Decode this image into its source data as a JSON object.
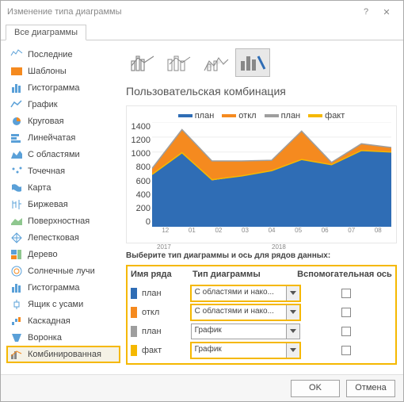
{
  "title": "Изменение типа диаграммы",
  "tab": "Все диаграммы",
  "sidebar": {
    "items": [
      {
        "label": "Последние"
      },
      {
        "label": "Шаблоны"
      },
      {
        "label": "Гистограмма"
      },
      {
        "label": "График"
      },
      {
        "label": "Круговая"
      },
      {
        "label": "Линейчатая"
      },
      {
        "label": "С областями"
      },
      {
        "label": "Точечная"
      },
      {
        "label": "Карта"
      },
      {
        "label": "Биржевая"
      },
      {
        "label": "Поверхностная"
      },
      {
        "label": "Лепестковая"
      },
      {
        "label": "Дерево"
      },
      {
        "label": "Солнечные лучи"
      },
      {
        "label": "Гистограмма"
      },
      {
        "label": "Ящик с усами"
      },
      {
        "label": "Каскадная"
      },
      {
        "label": "Воронка"
      },
      {
        "label": "Комбинированная"
      }
    ]
  },
  "heading": "Пользовательская комбинация",
  "legend": [
    {
      "name": "план",
      "color": "#2f6db5"
    },
    {
      "name": "откл",
      "color": "#f58a1f"
    },
    {
      "name": "план",
      "color": "#9e9e9e"
    },
    {
      "name": "факт",
      "color": "#f5b800"
    }
  ],
  "selector_label": "Выберите тип диаграммы и ось для рядов данных:",
  "columns": {
    "c1": "Имя ряда",
    "c2": "Тип диаграммы",
    "c3": "Вспомогательная ось"
  },
  "rows": [
    {
      "name": "план",
      "color": "#2f6db5",
      "type": "С областями и нако...",
      "hl": true,
      "aux": false
    },
    {
      "name": "откл",
      "color": "#f58a1f",
      "type": "С областями и нако...",
      "hl": true,
      "aux": false
    },
    {
      "name": "план",
      "color": "#9e9e9e",
      "type": "График",
      "hl": false,
      "aux": false
    },
    {
      "name": "факт",
      "color": "#f5b800",
      "type": "График",
      "hl": true,
      "aux": false
    }
  ],
  "buttons": {
    "ok": "OK",
    "cancel": "Отмена"
  },
  "chart_data": {
    "type": "area",
    "categories": [
      "12",
      "01",
      "02",
      "03",
      "04",
      "05",
      "06",
      "07",
      "08"
    ],
    "year_groups": [
      {
        "label": "2017",
        "span": 1
      },
      {
        "label": "2018",
        "span": 8
      }
    ],
    "ylim": [
      0,
      1400
    ],
    "yticks": [
      0,
      200,
      400,
      600,
      800,
      1000,
      1200,
      1400
    ],
    "series": [
      {
        "name": "план",
        "type": "area",
        "color": "#2f6db5",
        "values": [
          700,
          1000,
          620,
          680,
          750,
          900,
          830,
          1020,
          1000
        ]
      },
      {
        "name": "откл",
        "type": "area",
        "color": "#f58a1f",
        "values": [
          80,
          300,
          260,
          200,
          140,
          380,
          30,
          90,
          60
        ]
      },
      {
        "name": "план",
        "type": "line",
        "color": "#9e9e9e",
        "values": [
          780,
          1300,
          880,
          880,
          890,
          1280,
          860,
          1110,
          1060
        ]
      },
      {
        "name": "факт",
        "type": "line",
        "color": "#f5b800",
        "values": [
          700,
          990,
          630,
          680,
          750,
          900,
          830,
          1020,
          1000
        ]
      }
    ]
  }
}
